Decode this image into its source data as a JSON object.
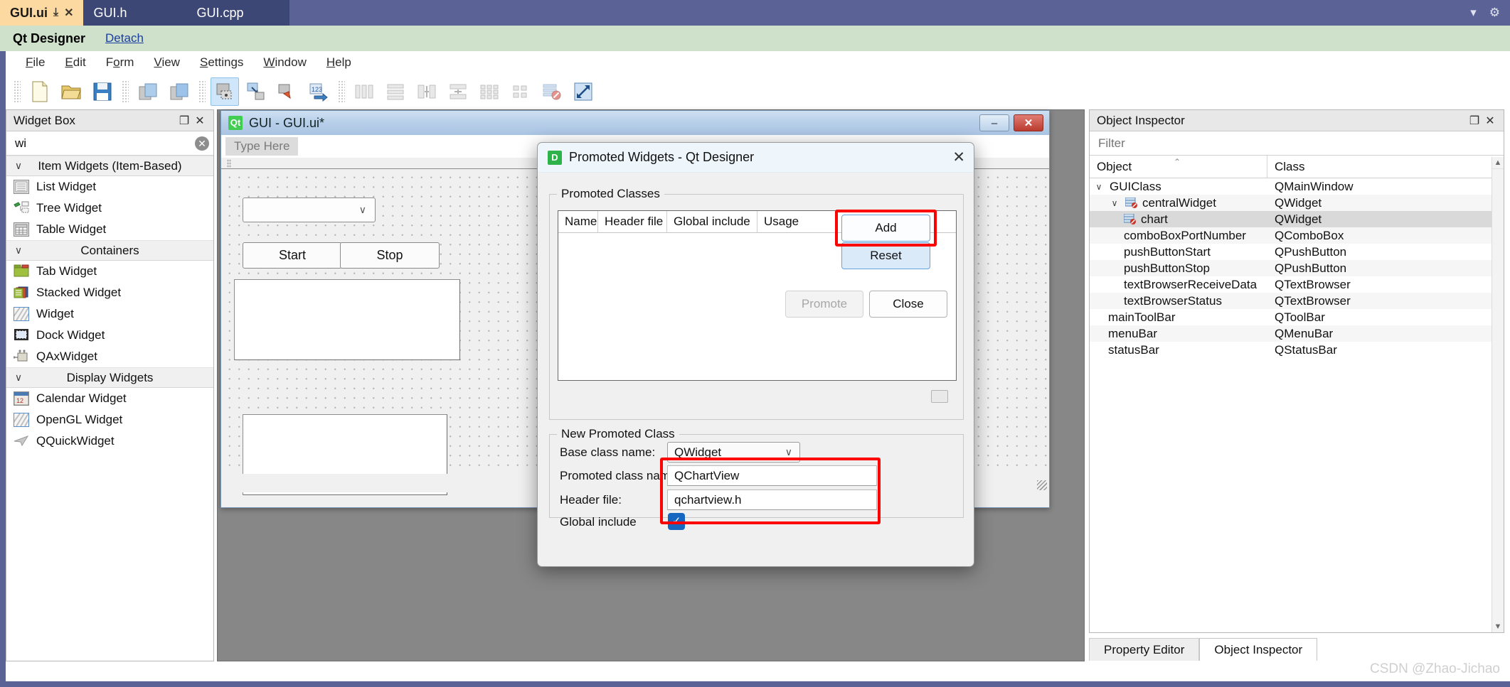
{
  "ide": {
    "tabs": [
      {
        "label": "GUI.ui",
        "active": true,
        "pin": "⤓",
        "close": "✕"
      },
      {
        "label": "GUI.h",
        "active": false
      },
      {
        "label": "GUI.cpp",
        "active": false
      }
    ],
    "window_controls": {
      "dropdown": "▾",
      "settings": "⚙"
    }
  },
  "host": {
    "title": "Qt Designer",
    "detach_label": "Detach"
  },
  "menubar": {
    "items": [
      {
        "pre": "",
        "hot": "F",
        "post": "ile"
      },
      {
        "pre": "",
        "hot": "E",
        "post": "dit"
      },
      {
        "pre": "F",
        "hot": "o",
        "post": "rm"
      },
      {
        "pre": "",
        "hot": "V",
        "post": "iew"
      },
      {
        "pre": "",
        "hot": "S",
        "post": "ettings"
      },
      {
        "pre": "",
        "hot": "W",
        "post": "indow"
      },
      {
        "pre": "",
        "hot": "H",
        "post": "elp"
      }
    ]
  },
  "toolbar": {
    "groups": [
      [
        "new-file-icon",
        "open-file-icon",
        "save-file-icon"
      ],
      [
        "undo-icon",
        "redo-icon"
      ],
      [
        "edit-widgets-icon",
        "edit-signals-slots-icon",
        "edit-buddies-icon",
        "edit-tab-order-icon"
      ],
      [
        "layout-horizontally-icon",
        "layout-vertically-icon",
        "layout-splitter-h-icon",
        "layout-splitter-v-icon",
        "layout-grid-icon",
        "layout-form-icon",
        "break-layout-icon",
        "adjust-size-icon"
      ]
    ]
  },
  "widget_box": {
    "panel_title": "Widget Box",
    "float_icon": "❐",
    "close_icon": "✕",
    "search_value": "wi",
    "search_placeholder": "Filter",
    "clear_icon": "✕",
    "chevron": "∨",
    "groups": [
      {
        "name": "Item Widgets (Item-Based)",
        "items": [
          {
            "label": "List Widget",
            "icon": "list-widget-icon"
          },
          {
            "label": "Tree Widget",
            "icon": "tree-widget-icon"
          },
          {
            "label": "Table Widget",
            "icon": "table-widget-icon"
          }
        ]
      },
      {
        "name": "Containers",
        "items": [
          {
            "label": "Tab Widget",
            "icon": "tab-widget-icon"
          },
          {
            "label": "Stacked Widget",
            "icon": "stacked-widget-icon"
          },
          {
            "label": "Widget",
            "icon": "widget-icon"
          },
          {
            "label": "Dock Widget",
            "icon": "dock-widget-icon"
          },
          {
            "label": "QAxWidget",
            "icon": "qaxwidget-icon"
          }
        ]
      },
      {
        "name": "Display Widgets",
        "items": [
          {
            "label": "Calendar Widget",
            "icon": "calendar-widget-icon"
          },
          {
            "label": "OpenGL Widget",
            "icon": "opengl-widget-icon"
          },
          {
            "label": "QQuickWidget",
            "icon": "qquickwidget-icon"
          }
        ]
      }
    ]
  },
  "form_window": {
    "title": "GUI - GUI.ui*",
    "logo_text": "Qt",
    "minimize_icon": "–",
    "close_icon": "✕",
    "menu_placeholder": "Type Here",
    "widgets": {
      "combo_box": {
        "name": "comboBoxPortNumber",
        "value": "",
        "chevron": "∨"
      },
      "start_button": "Start",
      "stop_button": "Stop",
      "text_browser_receive": "",
      "text_browser_status": ""
    }
  },
  "dialog": {
    "title": "Promoted Widgets - Qt Designer",
    "logo_text": "D",
    "close_icon": "✕",
    "promoted_classes": {
      "legend": "Promoted Classes",
      "columns": [
        "Name",
        "Header file",
        "Global include",
        "Usage"
      ],
      "rows": []
    },
    "new_promoted_class": {
      "legend": "New Promoted Class",
      "fields": [
        {
          "label": "Base class name:",
          "value": "QWidget",
          "type": "combobox",
          "chevron": "∨"
        },
        {
          "label": "Promoted class name:",
          "value": "QChartView",
          "type": "text"
        },
        {
          "label": "Header file:",
          "value": "qchartview.h",
          "type": "text"
        },
        {
          "label": "Global include",
          "value": "checked",
          "type": "checkbox",
          "check_glyph": "✓"
        }
      ]
    },
    "buttons": {
      "add": "Add",
      "reset": "Reset",
      "promote": "Promote",
      "close": "Close"
    },
    "highlight_color": "#fd0000"
  },
  "object_inspector": {
    "panel_title": "Object Inspector",
    "float_icon": "❐",
    "close_icon": "✕",
    "filter_placeholder": "Filter",
    "filter_value": "",
    "columns": [
      "Object",
      "Class"
    ],
    "sort_arrow": "⌃",
    "rows": [
      {
        "object": "GUIClass",
        "class": "QMainWindow",
        "indent": 0,
        "chevron": "∨",
        "icon": null,
        "selected": false
      },
      {
        "object": "centralWidget",
        "class": "QWidget",
        "indent": 1,
        "chevron": "∨",
        "icon": "widget-nolayout-icon",
        "selected": false
      },
      {
        "object": "chart",
        "class": "QWidget",
        "indent": 2,
        "chevron": "",
        "icon": "widget-nolayout-icon",
        "selected": true
      },
      {
        "object": "comboBoxPortNumber",
        "class": "QComboBox",
        "indent": 2,
        "chevron": "",
        "icon": null,
        "selected": false
      },
      {
        "object": "pushButtonStart",
        "class": "QPushButton",
        "indent": 2,
        "chevron": "",
        "icon": null,
        "selected": false
      },
      {
        "object": "pushButtonStop",
        "class": "QPushButton",
        "indent": 2,
        "chevron": "",
        "icon": null,
        "selected": false
      },
      {
        "object": "textBrowserReceiveData",
        "class": "QTextBrowser",
        "indent": 2,
        "chevron": "",
        "icon": null,
        "selected": false
      },
      {
        "object": "textBrowserStatus",
        "class": "QTextBrowser",
        "indent": 2,
        "chevron": "",
        "icon": null,
        "selected": false
      },
      {
        "object": "mainToolBar",
        "class": "QToolBar",
        "indent": 1,
        "chevron": "",
        "icon": null,
        "selected": false
      },
      {
        "object": "menuBar",
        "class": "QMenuBar",
        "indent": 1,
        "chevron": "",
        "icon": null,
        "selected": false
      },
      {
        "object": "statusBar",
        "class": "QStatusBar",
        "indent": 1,
        "chevron": "",
        "icon": null,
        "selected": false
      }
    ],
    "scroll_up_icon": "▲",
    "scroll_down_icon": "▼"
  },
  "dock_tabs": [
    {
      "label": "Property Editor",
      "active": false
    },
    {
      "label": "Object Inspector",
      "active": true
    }
  ],
  "watermark": "CSDN @Zhao-Jichao"
}
